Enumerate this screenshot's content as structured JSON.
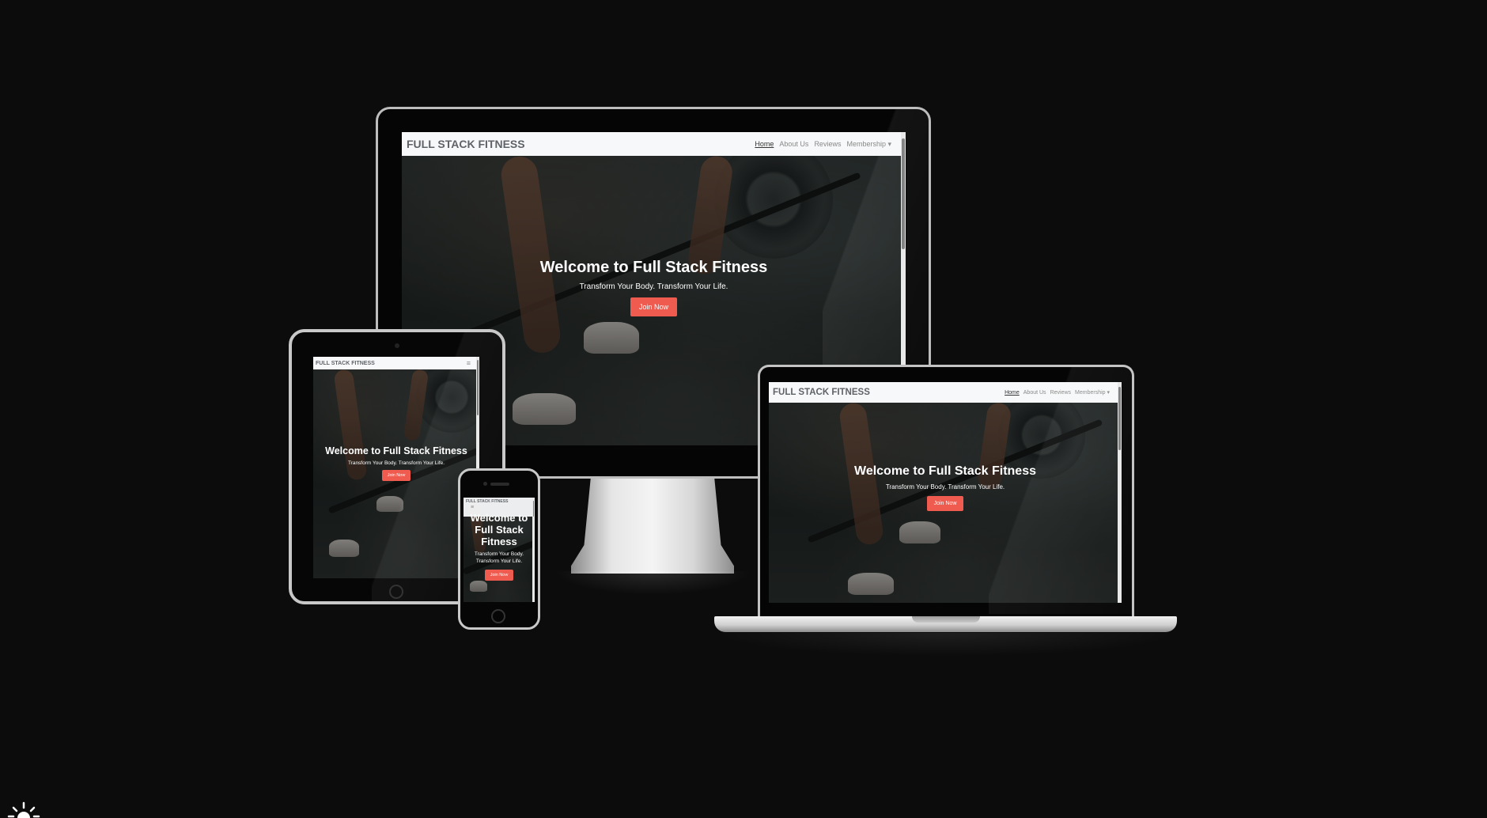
{
  "site": {
    "brand": "FULL STACK FITNESS",
    "nav": {
      "home": "Home",
      "about": "About Us",
      "reviews": "Reviews",
      "membership": "Membership ▾"
    },
    "hamburger": "≡",
    "hero": {
      "title": "Welcome to Full Stack Fitness",
      "subtitle": "Transform Your Body. Transform Your Life.",
      "button": "Join Now"
    },
    "phone_hero": {
      "title": "Welcome to Full Stack Fitness",
      "subtitle": "Transform Your Body. Transform Your Life."
    }
  },
  "colors": {
    "background": "#0d0c0d",
    "button": "#f05b4f",
    "navbar": "#f7f8f9"
  },
  "icons": {
    "theme_toggle": "sun-icon"
  }
}
